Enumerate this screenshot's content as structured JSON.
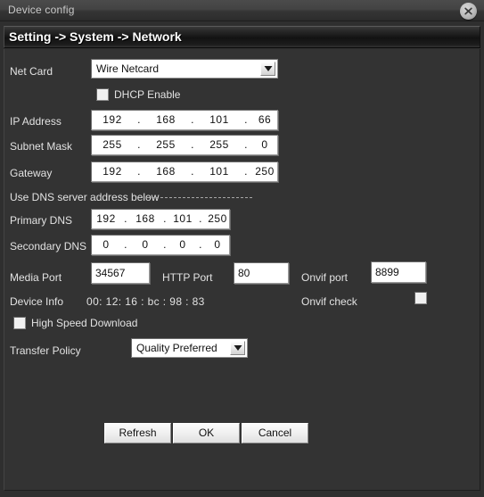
{
  "window": {
    "title": "Device config",
    "close_icon": "close-icon"
  },
  "section": {
    "header": "Setting -> System -> Network"
  },
  "form": {
    "net_card": {
      "label": "Net Card",
      "value": "Wire Netcard"
    },
    "dhcp": {
      "label": "DHCP Enable",
      "checked": false
    },
    "ip_address": {
      "label": "IP Address",
      "octets": [
        "192",
        "168",
        "101",
        "66"
      ]
    },
    "subnet_mask": {
      "label": "Subnet Mask",
      "octets": [
        "255",
        "255",
        "255",
        "0"
      ]
    },
    "gateway": {
      "label": "Gateway",
      "octets": [
        "192",
        "168",
        "101",
        "250"
      ]
    },
    "dns_note": "Use DNS server address below",
    "primary_dns": {
      "label": "Primary DNS",
      "octets": [
        "192",
        "168",
        "101",
        "250"
      ]
    },
    "secondary_dns": {
      "label": "Secondary DNS",
      "octets": [
        "0",
        "0",
        "0",
        "0"
      ]
    },
    "media_port": {
      "label": "Media Port",
      "value": "34567"
    },
    "http_port": {
      "label": "HTTP Port",
      "value": "80"
    },
    "onvif_port": {
      "label": "Onvif port",
      "value": "8899"
    },
    "device_info": {
      "label": "Device Info",
      "value": "00: 12: 16 :  bc  :  98 :  83"
    },
    "onvif_check": {
      "label": "Onvif check",
      "checked": false
    },
    "high_speed_download": {
      "label": "High Speed Download",
      "checked": false
    },
    "transfer_policy": {
      "label": "Transfer Policy",
      "value": "Quality Preferred"
    }
  },
  "buttons": {
    "refresh": "Refresh",
    "ok": "OK",
    "cancel": "Cancel"
  },
  "colors": {
    "window_bg": "#2f2f2f",
    "panel_bg": "#333333",
    "label_text": "#e2e2e2",
    "header_text": "#ffffff",
    "field_bg": "#ffffff"
  }
}
